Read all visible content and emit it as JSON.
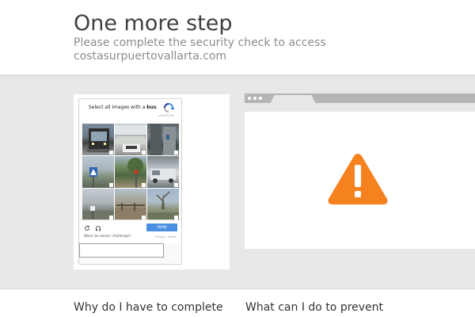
{
  "header": {
    "title": "One more step",
    "subtitle_line1": "Please complete the security check to access",
    "subtitle_line2": "costasurpuertovallarta.com"
  },
  "captcha": {
    "instruction_prefix": "Select all images with a ",
    "instruction_target": "bus",
    "instruction_suffix": ".",
    "logo_text": "reCAPTCHA",
    "tiles": [
      "tile-1",
      "tile-2",
      "tile-3",
      "tile-4",
      "tile-5",
      "tile-6",
      "tile-7",
      "tile-8",
      "tile-9"
    ],
    "reload_icon": "reload-icon",
    "audio_icon": "headphones-icon",
    "verify_label": "Verify",
    "easier_text": "Want an easier challenge?",
    "privacy_text": "Privacy - Terms",
    "answer_value": ""
  },
  "illustration": {
    "icon": "warning-icon",
    "accent_color": "#f6821f"
  },
  "sections": {
    "why_title": "Why do I have to complete a CAPTCHA?",
    "what_title": "What can I do to prevent this in the future?"
  }
}
